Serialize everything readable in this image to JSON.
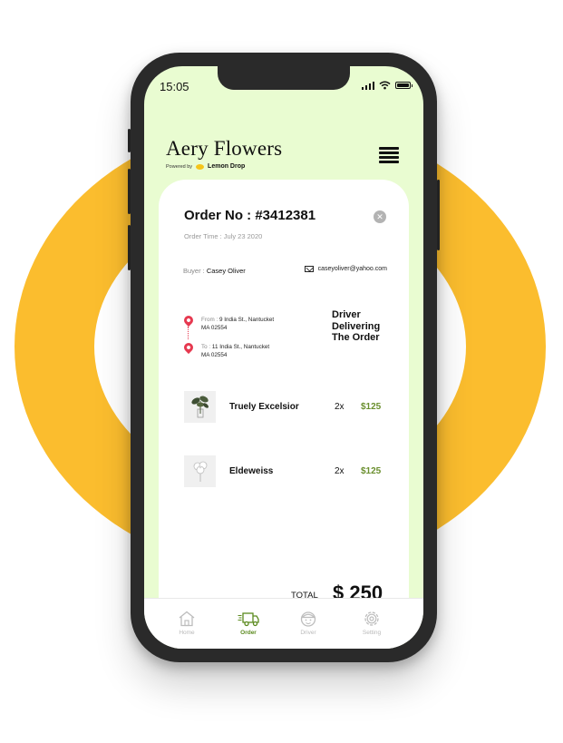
{
  "status_bar": {
    "time": "15:05"
  },
  "header": {
    "app_name": "Aery Flowers",
    "powered_by": "Powered by",
    "partner": "Lemon Drop"
  },
  "order": {
    "title": "Order No : #3412381",
    "time_label": "Order Time : July 23 2020",
    "buyer_label": "Buyer : ",
    "buyer_name": "Casey Oliver",
    "email": "caseyoliver@yahoo.com",
    "from_label": "From : ",
    "from_line1": "9 India St., Nantucket",
    "from_line2": "MA 02554",
    "to_label": "To : ",
    "to_line1": "11 India St., Nantucket",
    "to_line2": "MA 02554",
    "status": [
      "Driver",
      "Delivering",
      "The Order"
    ],
    "items": [
      {
        "name": "Truely Excelsior",
        "qty": "2x",
        "price": "$125"
      },
      {
        "name": "Eldeweiss",
        "qty": "2x",
        "price": "$125"
      }
    ],
    "total_label": "TOTAL",
    "total_value": "$ 250"
  },
  "tabs": [
    {
      "label": "Home",
      "icon": "home-icon"
    },
    {
      "label": "Order",
      "icon": "truck-icon"
    },
    {
      "label": "Driver",
      "icon": "driver-icon"
    },
    {
      "label": "Setting",
      "icon": "gear-icon"
    }
  ],
  "colors": {
    "ring": "#fbbd2e",
    "screen_bg": "#e9fcd1",
    "accent": "#5b8a1e",
    "price": "#6a8f2e",
    "pin": "#e63950"
  }
}
